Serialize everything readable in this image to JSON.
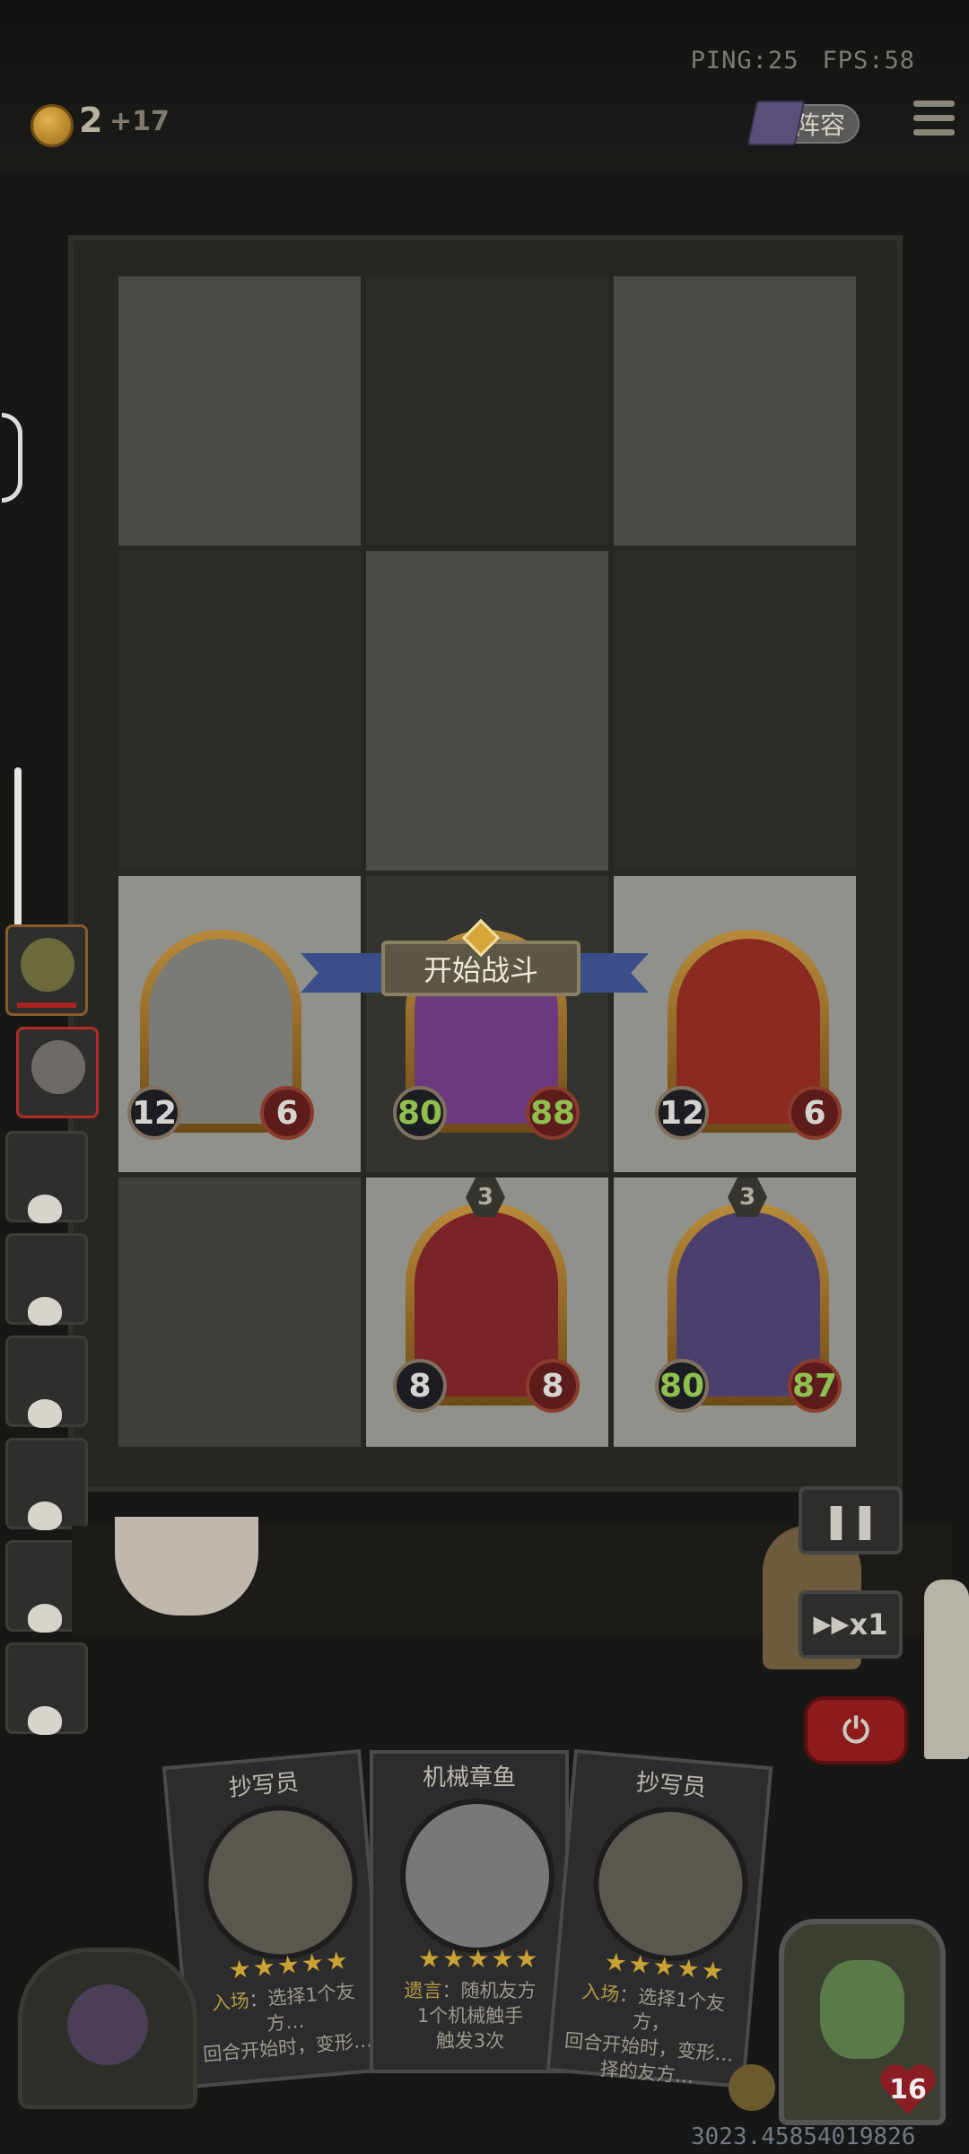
{
  "status": {
    "ping": "PING:25",
    "fps": "FPS:58"
  },
  "currency": {
    "count": "2",
    "bonus": "+17"
  },
  "menu": {
    "lineup_label": "阵容"
  },
  "banner": {
    "label": "开始战斗"
  },
  "board": {
    "cards": [
      {
        "id": "mech-octopus",
        "atk": "12",
        "hp": "6",
        "art": "#7a7a76"
      },
      {
        "id": "dragon",
        "atk": "80",
        "hp": "88",
        "art": "#6b3a7e"
      },
      {
        "id": "phoenix",
        "atk": "12",
        "hp": "6",
        "art": "#8a2a20"
      },
      {
        "id": "jester",
        "level": "3",
        "atk": "8",
        "hp": "8",
        "art": "#7a2328"
      },
      {
        "id": "rat",
        "level": "3",
        "atk": "80",
        "hp": "87",
        "art": "#4b3f6e"
      }
    ]
  },
  "controls": {
    "speed_label": "x1"
  },
  "hand": [
    {
      "title": "抄写员",
      "stars": "★★★★★",
      "text_kw": "入场",
      "text": "：选择1个友方…\n回合开始时，变形…"
    },
    {
      "title": "机械章鱼",
      "stars": "★★★★★",
      "text_kw": "遗言",
      "text": "：随机友方\n1个机械触手\n触发3次"
    },
    {
      "title": "抄写员",
      "stars": "★★★★★",
      "text_kw": "入场",
      "text": "：选择1个友方，\n回合开始时，变形…\n择的友方…"
    }
  ],
  "hero": {
    "hp": "16"
  },
  "seed": "3023.45854019826"
}
